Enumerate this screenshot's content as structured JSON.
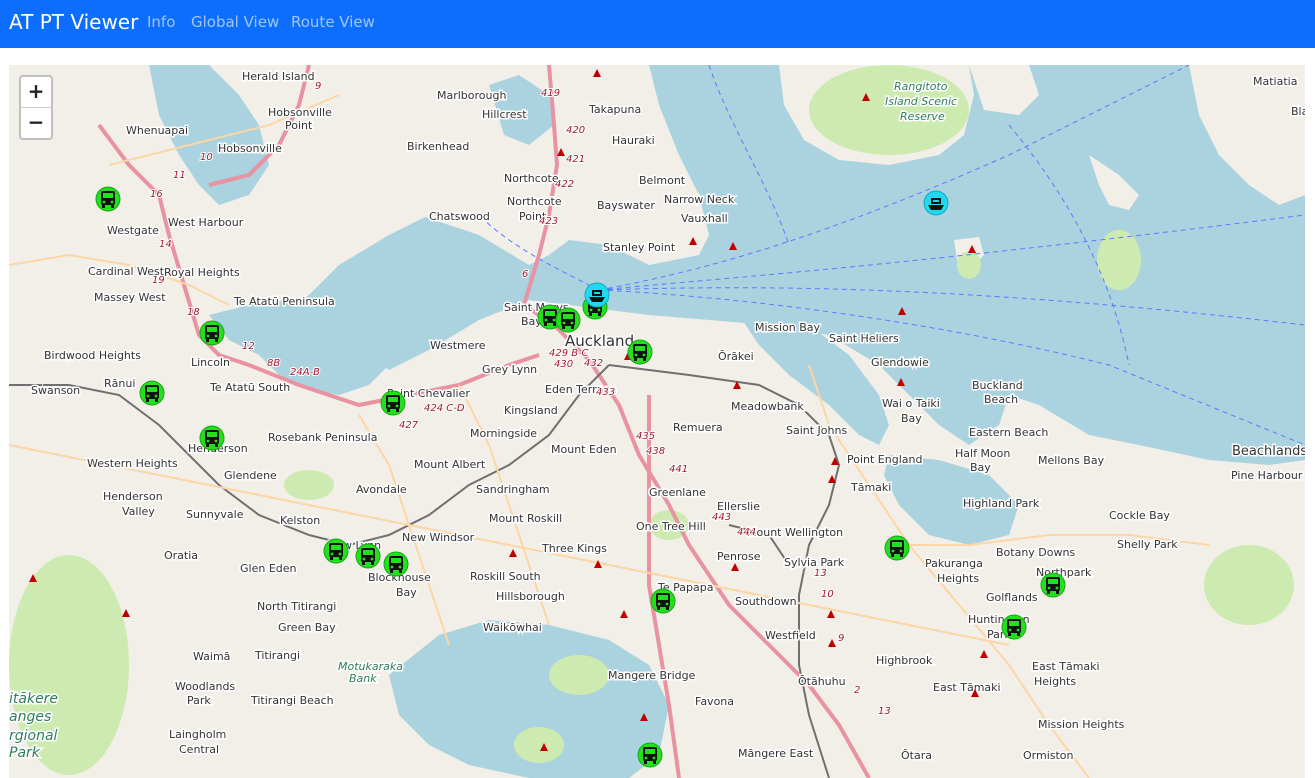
{
  "navbar": {
    "brand": "AT PT Viewer",
    "links": [
      "Info",
      "Global View",
      "Route View"
    ]
  },
  "map": {
    "zoom_in": "+",
    "zoom_out": "−",
    "places": [
      "Herald Island",
      "Marlborough",
      "Hillcrest",
      "Takapuna",
      "Hobsonville",
      "Point",
      "Whenuapai",
      "Hobsonville",
      "Birkenhead",
      "Hauraki",
      "Belmont",
      "Northcote",
      "Northcote",
      "Point",
      "Narrow Neck",
      "Bayswater",
      "Vauxhall",
      "Chatswood",
      "Stanley Point",
      "Westgate",
      "West Harbour",
      "Cardinal West",
      "Royal Heights",
      "Massey West",
      "Te Atatū Peninsula",
      "Saint Marys",
      "Bay",
      "Auckland",
      "Mission Bay",
      "Saint Heliers",
      "Westmere",
      "Grey Lynn",
      "Ōrākei",
      "Glendowie",
      "Birdwood Heights",
      "Lincoln",
      "Rānui",
      "Swanson",
      "Te Atatū South",
      "Point Chevalier",
      "Eden Terrace",
      "Kingsland",
      "Meadowbank",
      "Wai o Taiki",
      "Bay",
      "Buckland",
      "Beach",
      "Rosebank Peninsula",
      "Morningside",
      "Remuera",
      "Saint Johns",
      "Eastern Beach",
      "Henderson",
      "Western Heights",
      "Glendene",
      "Mount Eden",
      "Mount Albert",
      "Point England",
      "Half Moon",
      "Bay",
      "Mellons Bay",
      "Beachlands",
      "Pine Harbour",
      "Henderson",
      "Valley",
      "Avondale",
      "Sandringham",
      "Greenlane",
      "Tāmaki",
      "Ellerslie",
      "Highland Park",
      "Cockle Bay",
      "Sunnyvale",
      "Kelston",
      "Mount Roskill",
      "One Tree Hill",
      "Mount Wellington",
      "Oratia",
      "New Lynn",
      "New Windsor",
      "Three Kings",
      "Penrose",
      "Sylvia Park",
      "Pakuranga",
      "Heights",
      "Botany Downs",
      "Shelly Park",
      "Glen Eden",
      "Blockhouse",
      "Bay",
      "Roskill South",
      "Northpark",
      "Hillsborough",
      "Te Papapa",
      "Southdown",
      "Golflands",
      "North Titirangi",
      "Green Bay",
      "Waikōwhai",
      "Westfield",
      "Huntington",
      "Park",
      "Waimā",
      "Titirangi",
      "Mangere Bridge",
      "Highbrook",
      "East Tāmaki",
      "Heights",
      "Woodlands",
      "Park",
      "Titirangi Beach",
      "Ōtāhuhu",
      "East Tāmaki",
      "Favona",
      "Laingholm",
      "Central",
      "Māngere East",
      "Mission Heights",
      "Ōtara",
      "Ormiston",
      "Rangitoto",
      "Island Scenic",
      "Reserve",
      "Matiatia",
      "Blac",
      "Motukaraka",
      "Bank",
      "itākere",
      "anges",
      "rgional",
      "Park"
    ],
    "road_labels": [
      "419",
      "420",
      "421",
      "422",
      "423",
      "6",
      "9",
      "10",
      "11",
      "16",
      "18",
      "19",
      "14",
      "12",
      "8B",
      "24A-B",
      "424 C-D",
      "427",
      "429 B-C",
      "430",
      "432",
      "433",
      "435",
      "438",
      "441",
      "443",
      "444",
      "13",
      "10",
      "9",
      "2",
      "13"
    ],
    "markers": {
      "bus": 20,
      "ferry": 2,
      "peaks": 24
    }
  }
}
